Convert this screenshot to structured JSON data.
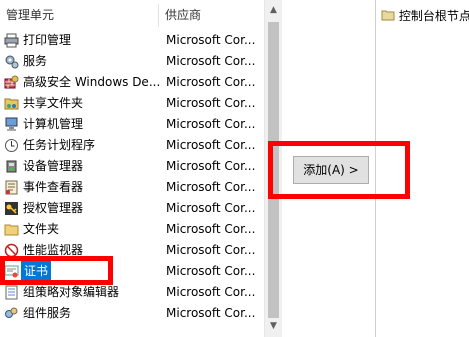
{
  "left_panel": {
    "col_name": "管理单元",
    "col_vendor": "供应商",
    "items": [
      {
        "name": "打印管理",
        "vendor": "Microsoft Cor...",
        "icon": "printer-icon"
      },
      {
        "name": "服务",
        "vendor": "Microsoft Cor...",
        "icon": "gears-icon"
      },
      {
        "name": "高级安全 Windows De...",
        "vendor": "Microsoft Cor...",
        "icon": "firewall-icon"
      },
      {
        "name": "共享文件夹",
        "vendor": "Microsoft Cor...",
        "icon": "shared-folder-icon"
      },
      {
        "name": "计算机管理",
        "vendor": "Microsoft Cor...",
        "icon": "computer-icon"
      },
      {
        "name": "任务计划程序",
        "vendor": "Microsoft Cor...",
        "icon": "clock-icon"
      },
      {
        "name": "设备管理器",
        "vendor": "Microsoft Cor...",
        "icon": "device-icon"
      },
      {
        "name": "事件查看器",
        "vendor": "Microsoft Cor...",
        "icon": "event-log-icon"
      },
      {
        "name": "授权管理器",
        "vendor": "Microsoft Cor...",
        "icon": "key-icon"
      },
      {
        "name": "文件夹",
        "vendor": "Microsoft Cor...",
        "icon": "folder-icon"
      },
      {
        "name": "性能监视器",
        "vendor": "Microsoft Cor...",
        "icon": "no-symbol-icon"
      },
      {
        "name": "证书",
        "vendor": "Microsoft Cor...",
        "icon": "certificate-icon",
        "selected": true
      },
      {
        "name": "组策略对象编辑器",
        "vendor": "Microsoft Cor...",
        "icon": "policy-icon"
      },
      {
        "name": "组件服务",
        "vendor": "Microsoft Cor...",
        "icon": "component-icon"
      }
    ]
  },
  "add_button": "添加(A) >",
  "right_panel": {
    "root_node": "控制台根节点"
  },
  "colors": {
    "selection": "#0078d7",
    "annotation": "#ff0000"
  }
}
